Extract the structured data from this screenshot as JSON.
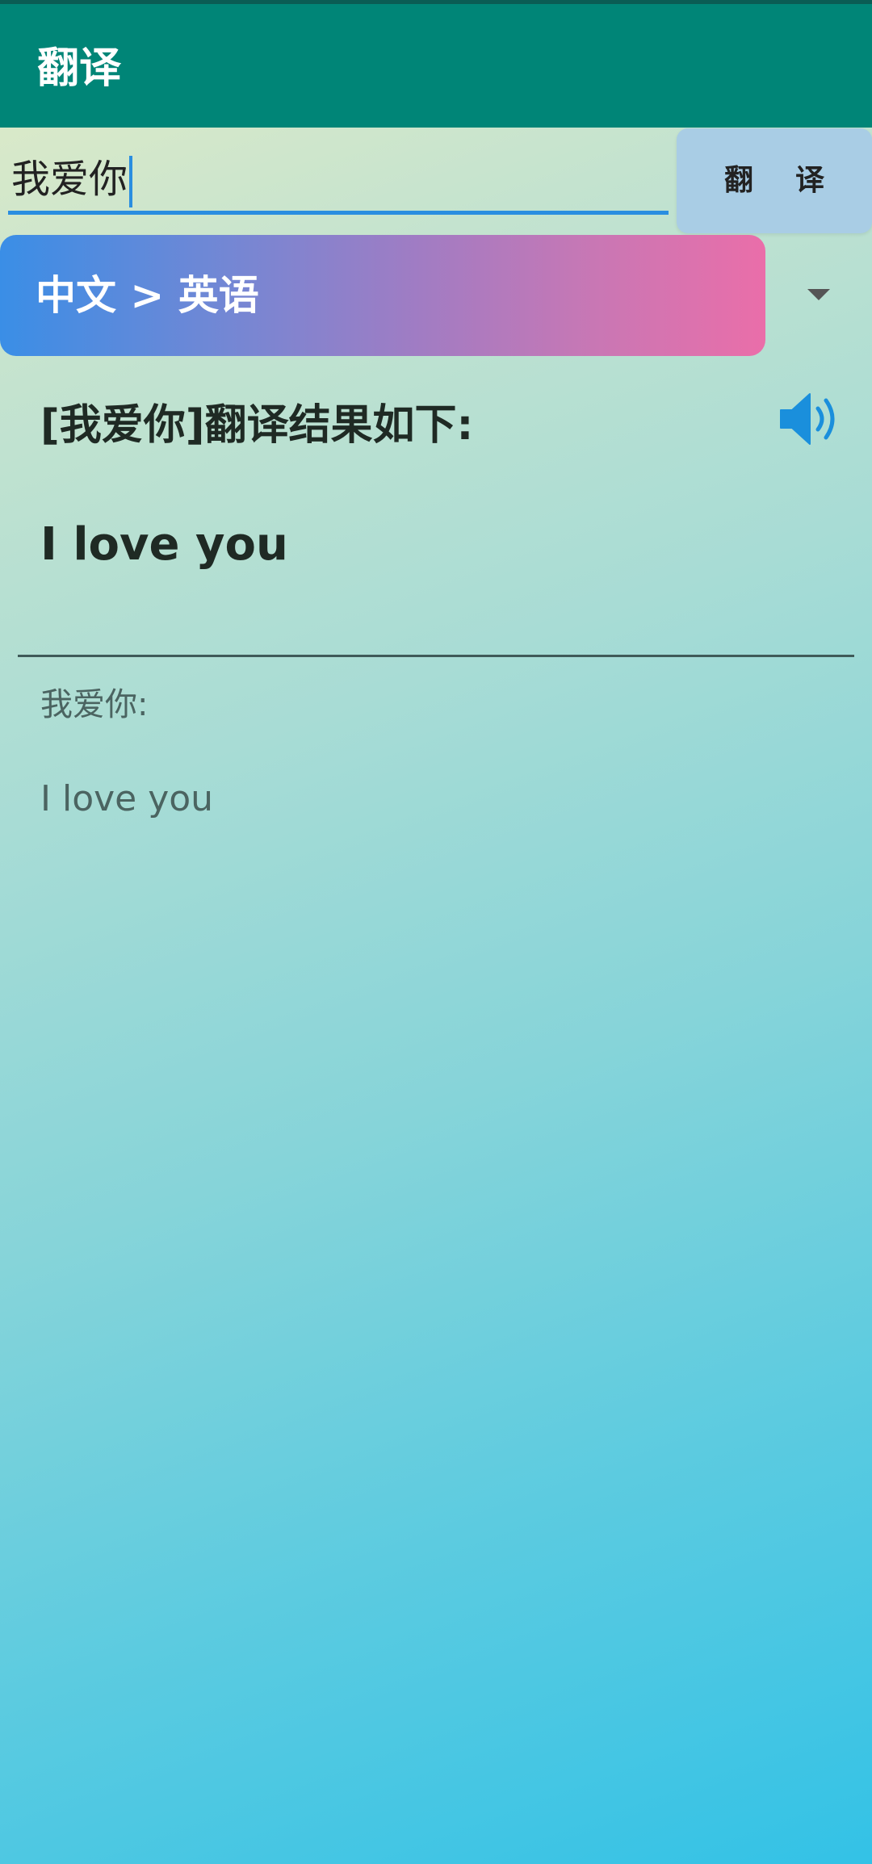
{
  "app_bar": {
    "title": "翻译"
  },
  "input": {
    "value": "我爱你"
  },
  "translate_button": {
    "label": "翻译"
  },
  "language": {
    "selected": "中文 > 英语"
  },
  "result": {
    "heading": "[我爱你]翻译结果如下:",
    "translation": "I love you"
  },
  "detail": {
    "source": "我爱你:",
    "translation": "I love you"
  },
  "icons": {
    "speaker": "speaker-icon",
    "dropdown": "chevron-down-icon"
  },
  "colors": {
    "app_bar": "#008577",
    "accent": "#2a8ee0",
    "button_bg": "#a9cde5",
    "speaker": "#1a8fdc"
  }
}
